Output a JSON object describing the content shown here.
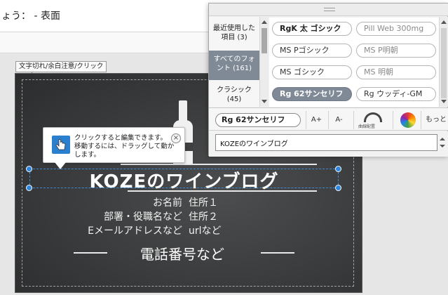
{
  "header": {
    "title": "ょう： - 表面"
  },
  "canvas": {
    "warning_label": "文字切れ/余白注意/クリック"
  },
  "card": {
    "title": "KOZEのワインブログ",
    "name_label": "お名前",
    "address1": "住所１",
    "dept_label": "部署・役職名など",
    "address2": "住所２",
    "email_label": "Eメールアドレスなど",
    "url_label": "urlなど",
    "phone_label": "電話番号など"
  },
  "tooltip": {
    "line1": "クリックすると編集できます。",
    "line2": "移動するには、ドラッグして動かします。",
    "close": "×"
  },
  "font_panel": {
    "categories": [
      {
        "label": "最近使用した項目 (3)",
        "active": false
      },
      {
        "label": "すべてのフォント (161)",
        "active": true
      },
      {
        "label": "クラシック (45)",
        "active": false
      }
    ],
    "fonts": [
      {
        "label": "RgK 太 ゴシック",
        "selected": false
      },
      {
        "label": "Pill Web 300mg",
        "selected": false
      },
      {
        "label": "MS Pゴシック",
        "selected": false
      },
      {
        "label": "MS P明朝",
        "selected": false
      },
      {
        "label": "MS ゴシック",
        "selected": false
      },
      {
        "label": "MS 明朝",
        "selected": false
      },
      {
        "label": "Rg 62サンセリフ",
        "selected": true
      },
      {
        "label": "Rg ウッディ-GM",
        "selected": false
      }
    ],
    "toolbar": {
      "current_font": "Rg 62サンセリフ",
      "size_up": "A+",
      "size_down": "A-",
      "curve_label": "曲線配置",
      "more_label": "もっと >"
    },
    "text_input_value": "KOZEのワインブログ"
  },
  "colors": {
    "accent": "#2e86de",
    "chalkboard": "#3a3b3c",
    "selected_font": "#808a96"
  },
  "icons": {
    "tooltip_icon": "hand-pointer-icon",
    "curve_icon": "curve-text-icon",
    "color_icon": "color-wheel-icon"
  }
}
